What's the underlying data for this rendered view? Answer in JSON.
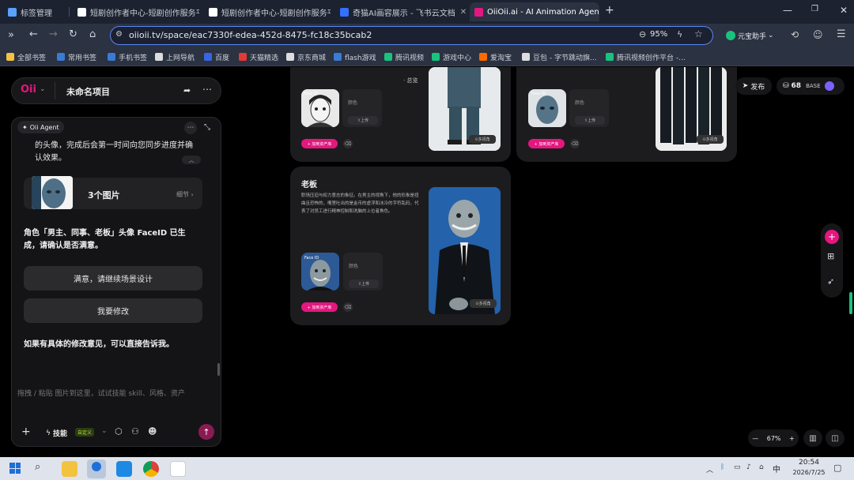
{
  "browser": {
    "tabs": [
      {
        "label": "标签管理",
        "fav": "#5aa0ff"
      },
      {
        "label": "短剧创作者中心-短剧创作服务平台",
        "fav": "#ffffff"
      },
      {
        "label": "短剧创作者中心-短剧创作服务平台",
        "fav": "#ffffff"
      },
      {
        "label": "奇猫AI画容展示 - 飞书云文档",
        "fav": "#3370ff"
      },
      {
        "label": "OiiOii.ai - AI Animation Agen",
        "fav": "#e5167f"
      }
    ],
    "new_tab": "+",
    "url": "oiioii.tv/space/eac7330f-edea-452d-8475-fc18c35bcab2",
    "zoom": "95%",
    "assistant_label": "元宝助手",
    "bookmarks": [
      "全部书签",
      "常用书签",
      "手机书签",
      "上网导航",
      "百度",
      "天猫精选",
      "京东商城",
      "flash游戏",
      "腾讯视频",
      "游戏中心",
      "爱淘宝",
      "豆包 - 字节跳动旗...",
      "腾讯视频创作平台 -..."
    ]
  },
  "app": {
    "logo": "Oii",
    "project_title": "未命名项目",
    "agent": {
      "badge": "Oii Agent",
      "msg_top": "的头像，完成后会第一时间向您同步进度并确认效果。",
      "image_group": {
        "label": "3个图片",
        "detail": "细节"
      },
      "msg_main": "角色「男主、同事、老板」头像 FaceID 已生成，请确认是否满意。",
      "btn_satisfied": "满意，请继续场景设计",
      "btn_modify": "我要修改",
      "msg_hint": "如果有具体的修改意见，可以直接告诉我。",
      "input_placeholder": "拖拽 / 粘贴  图片到这里，试试技能 skill、风格、资产",
      "skills_label": "技能",
      "custom_badge": "自定义"
    },
    "topbar": {
      "publish": "发布",
      "credits": "68",
      "plan": "BASE"
    },
    "canvas": {
      "card1": {
        "tab_overview": "总览",
        "tab_character": "角色",
        "color_label": "颜色",
        "upload": "上传",
        "faceid": "Face ID",
        "add_btn": "+ 加到资产库",
        "multiview": "多视角"
      },
      "card2": {
        "faceid": "Face ID",
        "color_label": "颜色",
        "upload": "上传",
        "add_btn": "+ 加到资产库",
        "multiview": "多视角"
      },
      "boss": {
        "title": "老板",
        "desc": "职场压迫与权力意志的象征。在男主的视角下，他的形象是扭曲且恐怖的，嘴里吐出的是金币的虚浮和冰冷的字符乱码，代表了对员工进行精神控制和洗脑的上位者角色。",
        "faceid": "Face ID",
        "color_label": "颜色",
        "upload": "上传",
        "add_btn": "+ 加到资产库",
        "multiview": "多视角"
      }
    },
    "zoom_level": "67%"
  },
  "taskbar": {
    "ime": "中",
    "time": "20:54",
    "date": "2026/7/25"
  }
}
